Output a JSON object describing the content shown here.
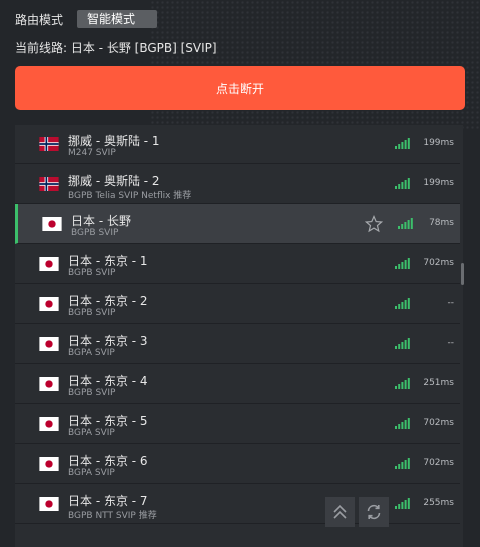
{
  "header": {
    "route_mode_label": "路由模式",
    "route_mode_value": "智能模式",
    "current_line_label": "当前线路:",
    "current_line_value": "日本 - 长野 [BGPB] [SVIP]",
    "disconnect_label": "点击断开"
  },
  "colors": {
    "accent": "#ff5a3c",
    "signal": "#3cbf6b",
    "active_marker": "#3cbf6b"
  },
  "servers": [
    {
      "name": "挪威 - 奥斯陆 - 1",
      "sub": "M247 SVIP",
      "ping": "199ms",
      "flag": "norway-flag",
      "active": false
    },
    {
      "name": "挪威 - 奥斯陆 - 2",
      "sub": "BGPB Telia SVIP Netflix 推荐",
      "ping": "199ms",
      "flag": "norway-flag",
      "active": false
    },
    {
      "name": "日本 - 长野",
      "sub": "BGPB SVIP",
      "ping": "78ms",
      "flag": "japan-flag",
      "active": true
    },
    {
      "name": "日本 - 东京 - 1",
      "sub": "BGPB SVIP",
      "ping": "702ms",
      "flag": "japan-flag",
      "active": false
    },
    {
      "name": "日本 - 东京 - 2",
      "sub": "BGPB SVIP",
      "ping": "--",
      "flag": "japan-flag",
      "active": false
    },
    {
      "name": "日本 - 东京 - 3",
      "sub": "BGPA SVIP",
      "ping": "--",
      "flag": "japan-flag",
      "active": false
    },
    {
      "name": "日本 - 东京 - 4",
      "sub": "BGPB SVIP",
      "ping": "251ms",
      "flag": "japan-flag",
      "active": false
    },
    {
      "name": "日本 - 东京 - 5",
      "sub": "BGPA SVIP",
      "ping": "702ms",
      "flag": "japan-flag",
      "active": false
    },
    {
      "name": "日本 - 东京 - 6",
      "sub": "BGPA SVIP",
      "ping": "702ms",
      "flag": "japan-flag",
      "active": false
    },
    {
      "name": "日本 - 东京 - 7",
      "sub": "BGPB NTT SVIP 推荐",
      "ping": "255ms",
      "flag": "japan-flag",
      "active": false
    }
  ]
}
